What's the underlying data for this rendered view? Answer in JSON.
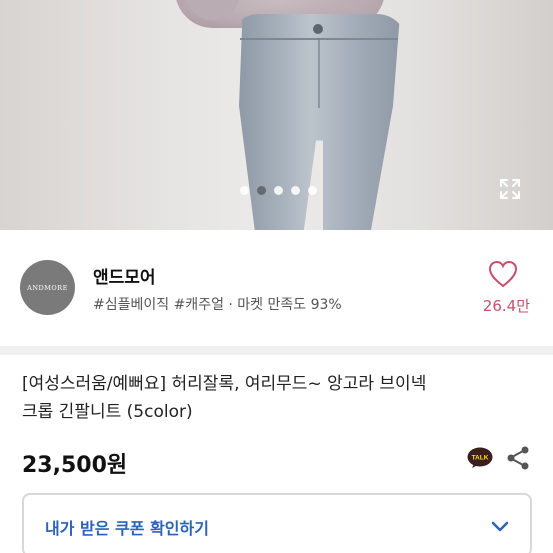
{
  "hero": {
    "carousel": {
      "count": 5,
      "active_index": 1
    },
    "expand_icon": "fullscreen-expand-icon"
  },
  "shop": {
    "logo_text": "ANDMORE",
    "name": "앤드모어",
    "tags": "#심플베이직 #캐주얼 · 마켓 만족도 93%",
    "like_count": "26.4만",
    "like_icon": "heart-outline-icon",
    "colors": {
      "like": "#c8516a"
    }
  },
  "product": {
    "title_line1": "[여성스러움/예뻐요] 허리잘록, 여리무드~ 앙고라 브이넥",
    "title_line2": "크롭 긴팔니트 (5color)",
    "price": "23,500원",
    "talk_icon": "kakao-talk-icon",
    "talk_label": "TALK",
    "share_icon": "share-icon"
  },
  "coupon": {
    "label": "내가 받은 쿠폰 확인하기",
    "icon": "chevron-down-icon",
    "colors": {
      "accent": "#2c63b8"
    }
  }
}
